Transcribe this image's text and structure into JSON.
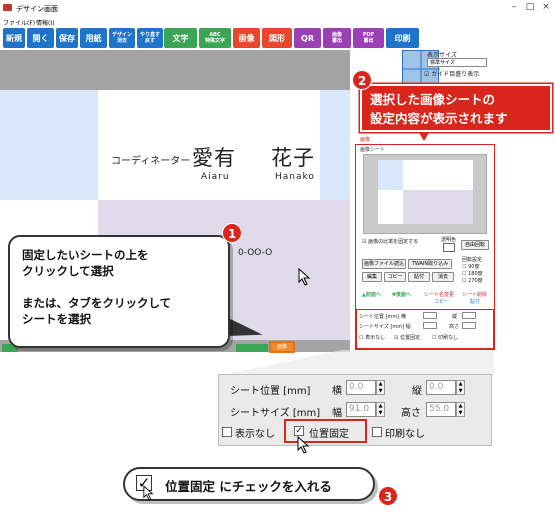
{
  "window": {
    "title": "デザイン画面",
    "minimize": "–",
    "maximize": "□",
    "close": "×"
  },
  "menu": {
    "file": "ファイル(F)",
    "info": "情報(I)"
  },
  "toolbar": [
    {
      "label": "新規",
      "color": "#1f74c9"
    },
    {
      "label": "開く",
      "color": "#1f74c9"
    },
    {
      "label": "保存",
      "color": "#1f74c9"
    },
    {
      "label": "用紙",
      "color": "#1f74c9"
    },
    {
      "label": "デザイン\n消去",
      "color": "#1f74c9"
    },
    {
      "label": "やり直す\n戻す",
      "color": "#1f74c9"
    },
    {
      "label": "文字",
      "color": "#3aa655"
    },
    {
      "label": "ABC\n特殊文字",
      "color": "#3aa655"
    },
    {
      "label": "画像",
      "color": "#e8472e"
    },
    {
      "label": "図形",
      "color": "#e8472e"
    },
    {
      "label": "QR",
      "color": "#9b3fb5"
    },
    {
      "label": "画像\n書出",
      "color": "#9b3fb5"
    },
    {
      "label": "PDF\n書出",
      "color": "#9b3fb5"
    },
    {
      "label": "印刷",
      "color": "#1f74c9"
    }
  ],
  "card": {
    "role": "コーディネーター",
    "name_family": "愛有",
    "name_given": "花子",
    "roman_family": "Aiaru",
    "roman_given": "Hanako",
    "phone": "0-OO-O"
  },
  "callouts": {
    "one_badge": "1",
    "one_line1": "固定したいシートの上を",
    "one_line2": "クリックして選択",
    "one_line3": "または、タブをクリックして",
    "one_line4": "シートを選択",
    "two_badge": "2",
    "two_line1": "選択した画像シートの",
    "two_line2": "設定内容が表示されます",
    "three_badge": "3",
    "three_text": "位置固定 にチェックを入れる",
    "three_check": "✓"
  },
  "right_panel": {
    "display_size_label": "表示サイズ",
    "display_size_value": "標準サイズ",
    "guide_label": "ガイド目盛り表示",
    "sheet_label": "画像",
    "image_sheet_tab": "画像シート",
    "keep_ratio": "画像の比率を固定する",
    "transparent": "透明色",
    "free_rotate": "自由回転",
    "load_image": "画像ファイル読込",
    "twain": "TWAIN取り込み",
    "edit": "編集",
    "copy": "コピー",
    "paste": "貼付",
    "clear": "消去",
    "prev": "▲前面へ",
    "next": "▼後面へ",
    "sheet_name_change": "シート名変更",
    "sheet_delete": "シート削除",
    "copy2": "コピー",
    "paste2": "貼付",
    "sheet_pos_label": "シート位置 [mm] 横",
    "sheet_size_label": "シートサイズ [mm] 幅",
    "vert": "縦",
    "height": "高さ",
    "no_display": "表示なし",
    "lock_pos": "位置固定",
    "no_print": "印刷なし",
    "rotate": "回転設定",
    "r90": "90度",
    "r180": "180度",
    "r270": "270度"
  },
  "zoom": {
    "pos_label": "シート位置 [mm]",
    "horizontal": "横",
    "horizontal_value": "0.0",
    "vertical": "縦",
    "vertical_value": "0.0",
    "size_label": "シートサイズ [mm]",
    "width": "幅",
    "width_value": "91.0",
    "height": "高さ",
    "height_value": "55.0",
    "no_display": "表示なし",
    "lock_pos": "位置固定",
    "no_print": "印刷なし",
    "check": "✓"
  },
  "tab_selected": "画像"
}
